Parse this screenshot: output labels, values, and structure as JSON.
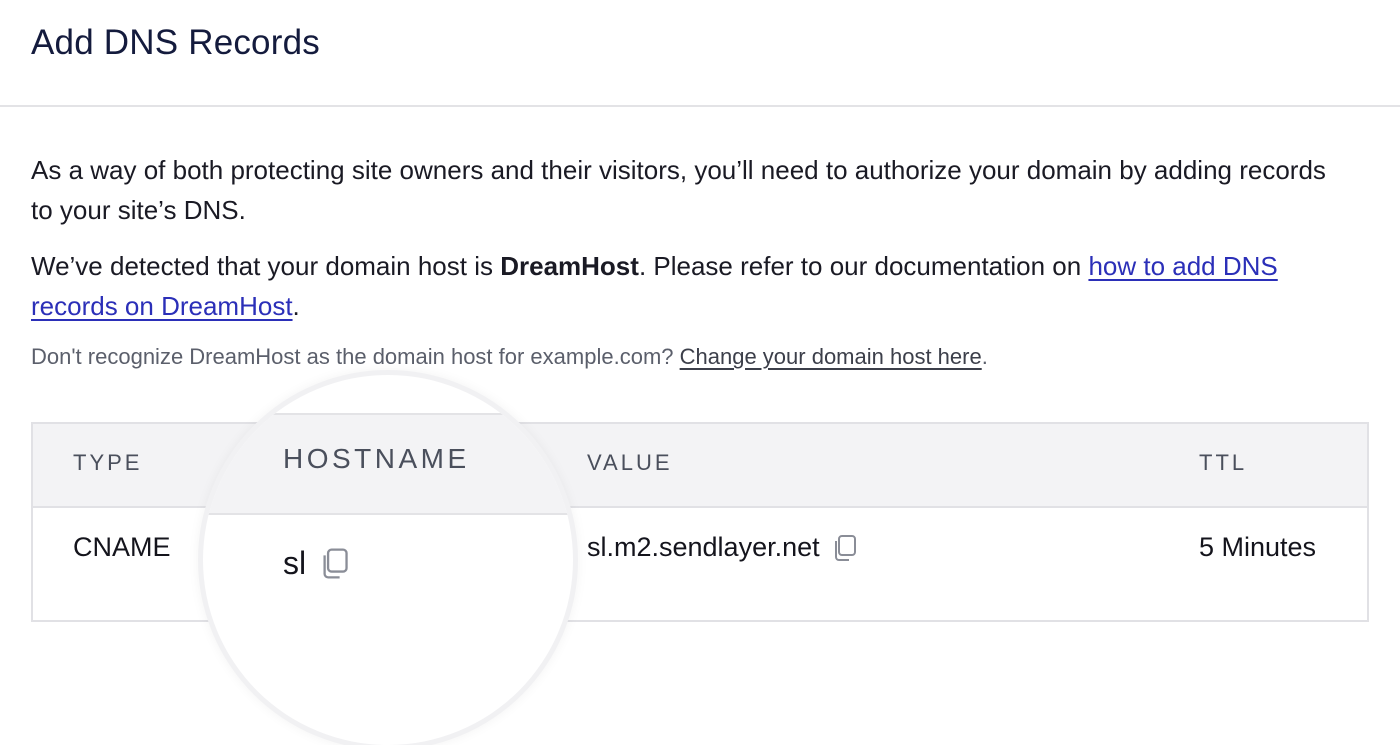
{
  "header": {
    "title": "Add DNS Records"
  },
  "intro": {
    "paragraph1": "As a way of both protecting site owners and their visitors, you’ll need to authorize your domain by adding records to your site’s DNS.",
    "detected_prefix": "We’ve detected that your domain host is ",
    "host_name": "DreamHost",
    "detected_middle": ". Please refer to our documentation on ",
    "docs_link": "how to add DNS records on DreamHost",
    "detected_suffix": ".",
    "hint_prefix": "Don't recognize DreamHost as the domain host for example.com? ",
    "hint_link": "Change your domain host here",
    "hint_suffix": "."
  },
  "table": {
    "columns": {
      "type": "TYPE",
      "hostname": "HOSTNAME",
      "value": "VALUE",
      "ttl": "TTL"
    },
    "rows": [
      {
        "type": "CNAME",
        "hostname": "sl",
        "value": "sl.m2.sendlayer.net",
        "ttl": "5 Minutes"
      }
    ]
  },
  "icons": {
    "copy": "copy-icon"
  },
  "colors": {
    "link": "#2b2fb8",
    "header_bg": "#f3f3f5",
    "border": "#e1e1e5"
  }
}
